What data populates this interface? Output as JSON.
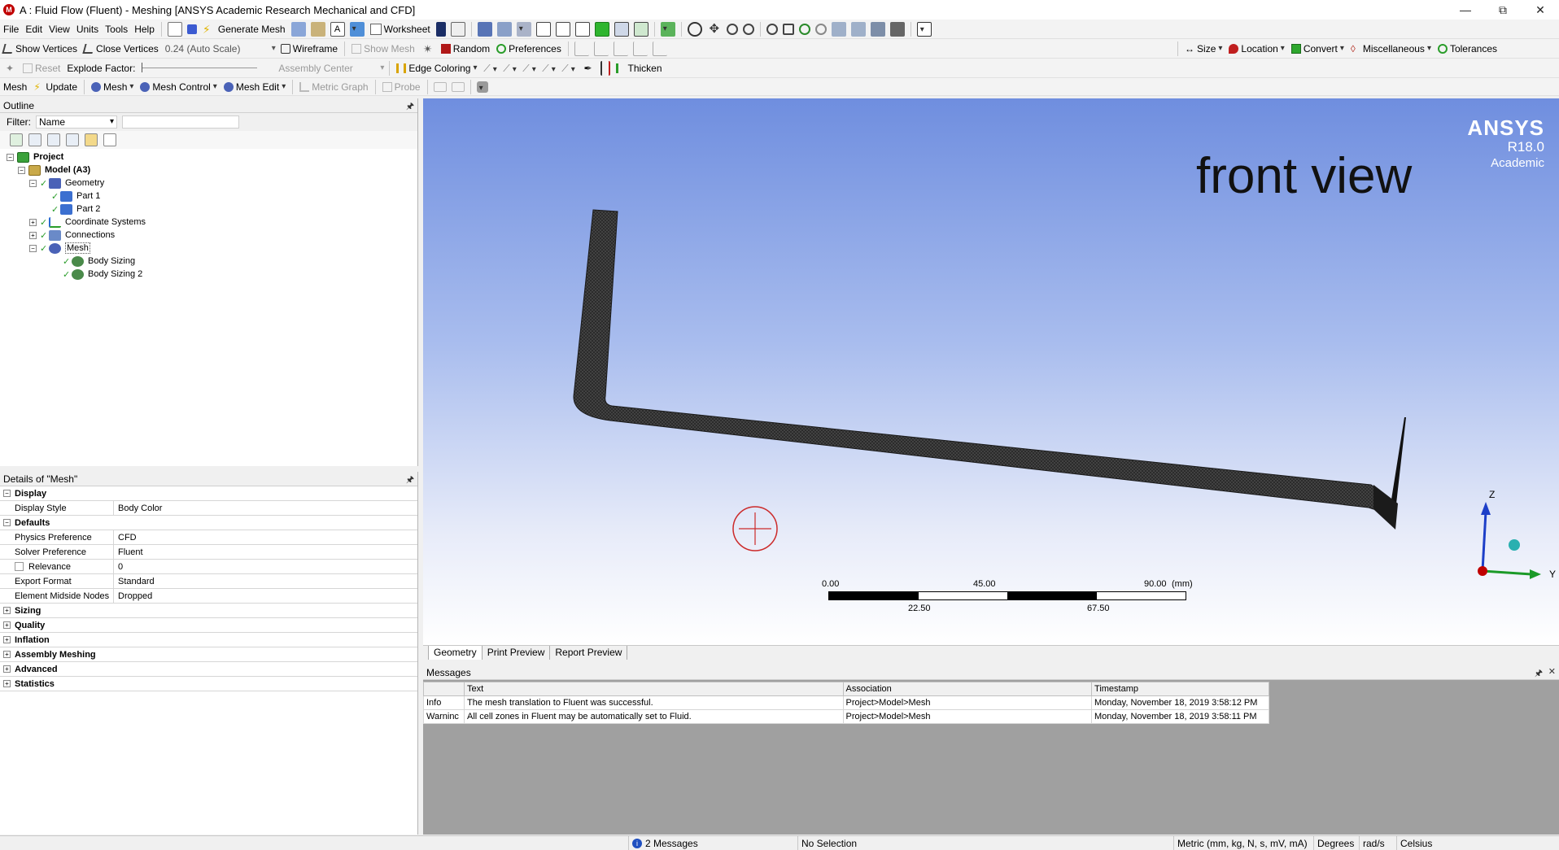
{
  "window": {
    "title": "A : Fluid Flow (Fluent) - Meshing [ANSYS Academic Research Mechanical and CFD]",
    "app_icon_letter": "M"
  },
  "menu": [
    "File",
    "Edit",
    "View",
    "Units",
    "Tools",
    "Help"
  ],
  "toolbar1": {
    "generate_mesh": "Generate Mesh",
    "worksheet": "Worksheet"
  },
  "toolbar2": {
    "show_vertices": "Show Vertices",
    "close_vertices": "Close Vertices",
    "scale_value": "0.24 (Auto Scale)",
    "wireframe": "Wireframe",
    "show_mesh": "Show Mesh",
    "random": "Random",
    "preferences": "Preferences",
    "size": "Size",
    "location": "Location",
    "convert": "Convert",
    "miscellaneous": "Miscellaneous",
    "tolerances": "Tolerances"
  },
  "toolbar3": {
    "reset": "Reset",
    "explode_factor": "Explode Factor:",
    "assembly_center": "Assembly Center",
    "edge_coloring": "Edge Coloring",
    "thicken": "Thicken"
  },
  "toolbar4": {
    "mesh_label": "Mesh",
    "update": "Update",
    "mesh": "Mesh",
    "mesh_control": "Mesh Control",
    "mesh_edit": "Mesh Edit",
    "metric_graph": "Metric Graph",
    "probe": "Probe"
  },
  "outline": {
    "title": "Outline",
    "filter_label": "Filter:",
    "filter_value": "Name",
    "nodes": [
      {
        "label": "Project",
        "level": 0,
        "bold": true
      },
      {
        "label": "Model (A3)",
        "level": 1,
        "bold": true
      },
      {
        "label": "Geometry",
        "level": 2
      },
      {
        "label": "Part 1",
        "level": 3
      },
      {
        "label": "Part 2",
        "level": 3
      },
      {
        "label": "Coordinate Systems",
        "level": 2
      },
      {
        "label": "Connections",
        "level": 2
      },
      {
        "label": "Mesh",
        "level": 2
      },
      {
        "label": "Body Sizing",
        "level": 3
      },
      {
        "label": "Body Sizing 2",
        "level": 3
      }
    ]
  },
  "details": {
    "title": "Details of \"Mesh\"",
    "groups": {
      "display": "Display",
      "defaults": "Defaults",
      "sizing": "Sizing",
      "quality": "Quality",
      "inflation": "Inflation",
      "assembly_meshing": "Assembly Meshing",
      "advanced": "Advanced",
      "statistics": "Statistics"
    },
    "rows": {
      "display_style": {
        "k": "Display Style",
        "v": "Body Color"
      },
      "physics_preference": {
        "k": "Physics Preference",
        "v": "CFD"
      },
      "solver_preference": {
        "k": "Solver Preference",
        "v": "Fluent"
      },
      "relevance": {
        "k": "Relevance",
        "v": "0"
      },
      "export_format": {
        "k": "Export Format",
        "v": "Standard"
      },
      "element_midside_nodes": {
        "k": "Element Midside Nodes",
        "v": "Dropped"
      }
    }
  },
  "viewport": {
    "brand": "ANSYS",
    "version": "R18.0",
    "edition": "Academic",
    "view_label": "front view",
    "scale": {
      "top_labels": [
        "0.00",
        "45.00",
        "90.00"
      ],
      "unit": "(mm)",
      "bottom_labels": [
        "22.50",
        "67.50"
      ]
    },
    "axes": {
      "z": "Z",
      "y": "Y"
    }
  },
  "viewtabs": [
    "Geometry",
    "Print Preview",
    "Report Preview"
  ],
  "messages": {
    "title": "Messages",
    "columns": [
      "Text",
      "Association",
      "Timestamp"
    ],
    "rows": [
      {
        "type": "Info",
        "text": "The mesh translation to Fluent was successful.",
        "association": "Project>Model>Mesh",
        "timestamp": "Monday, November 18, 2019 3:58:12 PM"
      },
      {
        "type": "Warninc",
        "text": "All cell zones in Fluent may be automatically set to Fluid.",
        "association": "Project>Model>Mesh",
        "timestamp": "Monday, November 18, 2019 3:58:11 PM"
      }
    ]
  },
  "statusbar": {
    "messages": "2 Messages",
    "selection": "No Selection",
    "units": "Metric (mm, kg, N, s, mV, mA)",
    "angle": "Degrees",
    "rotation": "rad/s",
    "temperature": "Celsius"
  },
  "colors": {
    "accent_green": "#2a9d2a",
    "viewport_top": "#6f8edf",
    "mesh_body": "#2b2b2b"
  }
}
